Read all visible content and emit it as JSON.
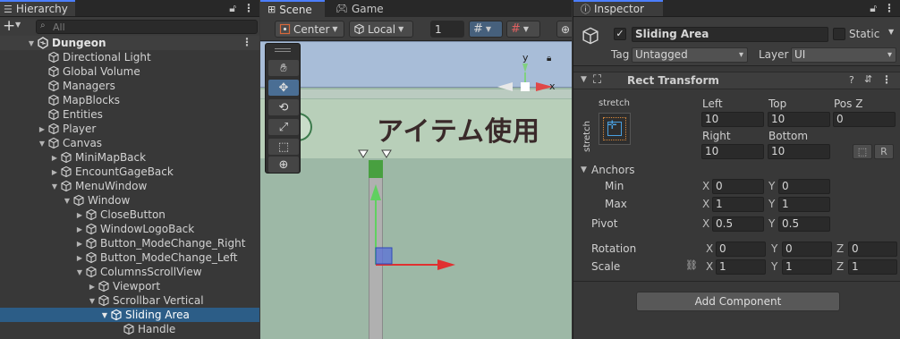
{
  "hierarchy": {
    "tab_label": "Hierarchy",
    "search_placeholder": "All",
    "scene_name": "Dungeon",
    "items": [
      {
        "label": "Directional Light"
      },
      {
        "label": "Global Volume"
      },
      {
        "label": "Managers"
      },
      {
        "label": "MapBlocks"
      },
      {
        "label": "Entities"
      },
      {
        "label": "Player"
      },
      {
        "label": "Canvas"
      },
      {
        "label": "MiniMapBack"
      },
      {
        "label": "EncountGageBack"
      },
      {
        "label": "MenuWindow"
      },
      {
        "label": "Window"
      },
      {
        "label": "CloseButton"
      },
      {
        "label": "WindowLogoBack"
      },
      {
        "label": "Button_ModeChange_Right"
      },
      {
        "label": "Button_ModeChange_Left"
      },
      {
        "label": "ColumnsScrollView"
      },
      {
        "label": "Viewport"
      },
      {
        "label": "Scrollbar Vertical"
      },
      {
        "label": "Sliding Area"
      },
      {
        "label": "Handle"
      }
    ]
  },
  "scene": {
    "tabs": [
      {
        "label": "Scene"
      },
      {
        "label": "Game"
      }
    ],
    "pivot_mode": "Center",
    "pivot_rotation": "Local",
    "grid_value": "1",
    "title_text": "アイテム使用",
    "gizmo_x": "x",
    "gizmo_y": "y"
  },
  "inspector": {
    "tab_label": "Inspector",
    "object_name": "Sliding Area",
    "static_label": "Static",
    "tag_label": "Tag",
    "tag_value": "Untagged",
    "layer_label": "Layer",
    "layer_value": "UI",
    "component_title": "Rect Transform",
    "anchor_preset_top": "stretch",
    "anchor_preset_side": "stretch",
    "left_label": "Left",
    "left_value": "10",
    "top_label": "Top",
    "top_value": "10",
    "posz_label": "Pos Z",
    "posz_value": "0",
    "right_label": "Right",
    "right_value": "10",
    "bottom_label": "Bottom",
    "bottom_value": "10",
    "r_button": "R",
    "anchors_label": "Anchors",
    "min_label": "Min",
    "min_x": "0",
    "min_y": "0",
    "max_label": "Max",
    "max_x": "1",
    "max_y": "1",
    "pivot_label": "Pivot",
    "pivot_x": "0.5",
    "pivot_y": "0.5",
    "rotation_label": "Rotation",
    "rot_x": "0",
    "rot_y": "0",
    "rot_z": "0",
    "scale_label": "Scale",
    "scale_x": "1",
    "scale_y": "1",
    "scale_z": "1",
    "x_letter": "X",
    "y_letter": "Y",
    "z_letter": "Z",
    "add_component": "Add Component"
  },
  "colors": {
    "accent": "#4c7efd",
    "selection": "#2c5d87",
    "scene_bg": "#9db8a6"
  }
}
